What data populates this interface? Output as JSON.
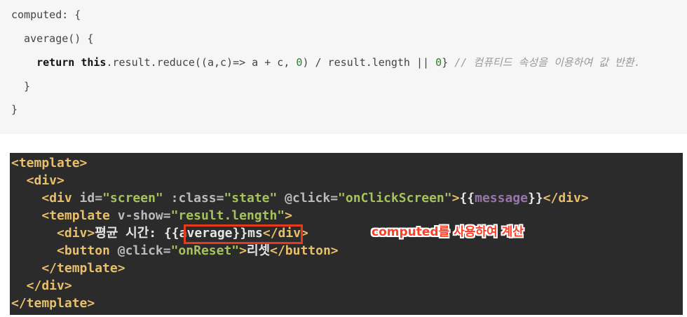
{
  "top_code": {
    "line1": "computed: {",
    "line2": "  average() {",
    "line3_kw1": "    return",
    "line3_sp": " ",
    "line3_kw2": "this",
    "line3_a": ".result.reduce((a,c)=> a + c, ",
    "line3_n1": "0",
    "line3_b": ") / result.length || ",
    "line3_n2": "0",
    "line3_c": "} ",
    "line3_comment": "// 컴퓨티드 속성을 이용하여 값 반환.",
    "line4": "  }",
    "line5": "}"
  },
  "screenshot_code": {
    "l1": "<template>",
    "l2": "  <div>",
    "l3_i": "    ",
    "l3_t1": "<div ",
    "l3_a1": "id=",
    "l3_v1": "\"screen\"",
    "l3_sp1": " ",
    "l3_a2": ":class=",
    "l3_v2": "\"state\"",
    "l3_sp2": " ",
    "l3_a3": "@click=",
    "l3_v3": "\"onClickScreen\"",
    "l3_t2": ">",
    "l3_x1": "{{",
    "l3_m": "message",
    "l3_x2": "}}",
    "l3_t3": "</div>",
    "l4_i": "    ",
    "l4_t1": "<template ",
    "l4_a1": "v-show=",
    "l4_v1": "\"result.length\"",
    "l4_t2": ">",
    "l5_i": "      ",
    "l5_t1": "<div>",
    "l5_x": "평균 시간: {{average}}ms",
    "l5_t2": "</div>",
    "l6_i": "      ",
    "l6_t1": "<button ",
    "l6_a1": "@click=",
    "l6_v1": "\"onReset\"",
    "l6_t2": ">",
    "l6_x": "리셋",
    "l6_t3": "</button>",
    "l7": "    </template>",
    "l8": "  </div>",
    "l9": "</template>"
  },
  "annotation": "computed를 사용하여 계산"
}
